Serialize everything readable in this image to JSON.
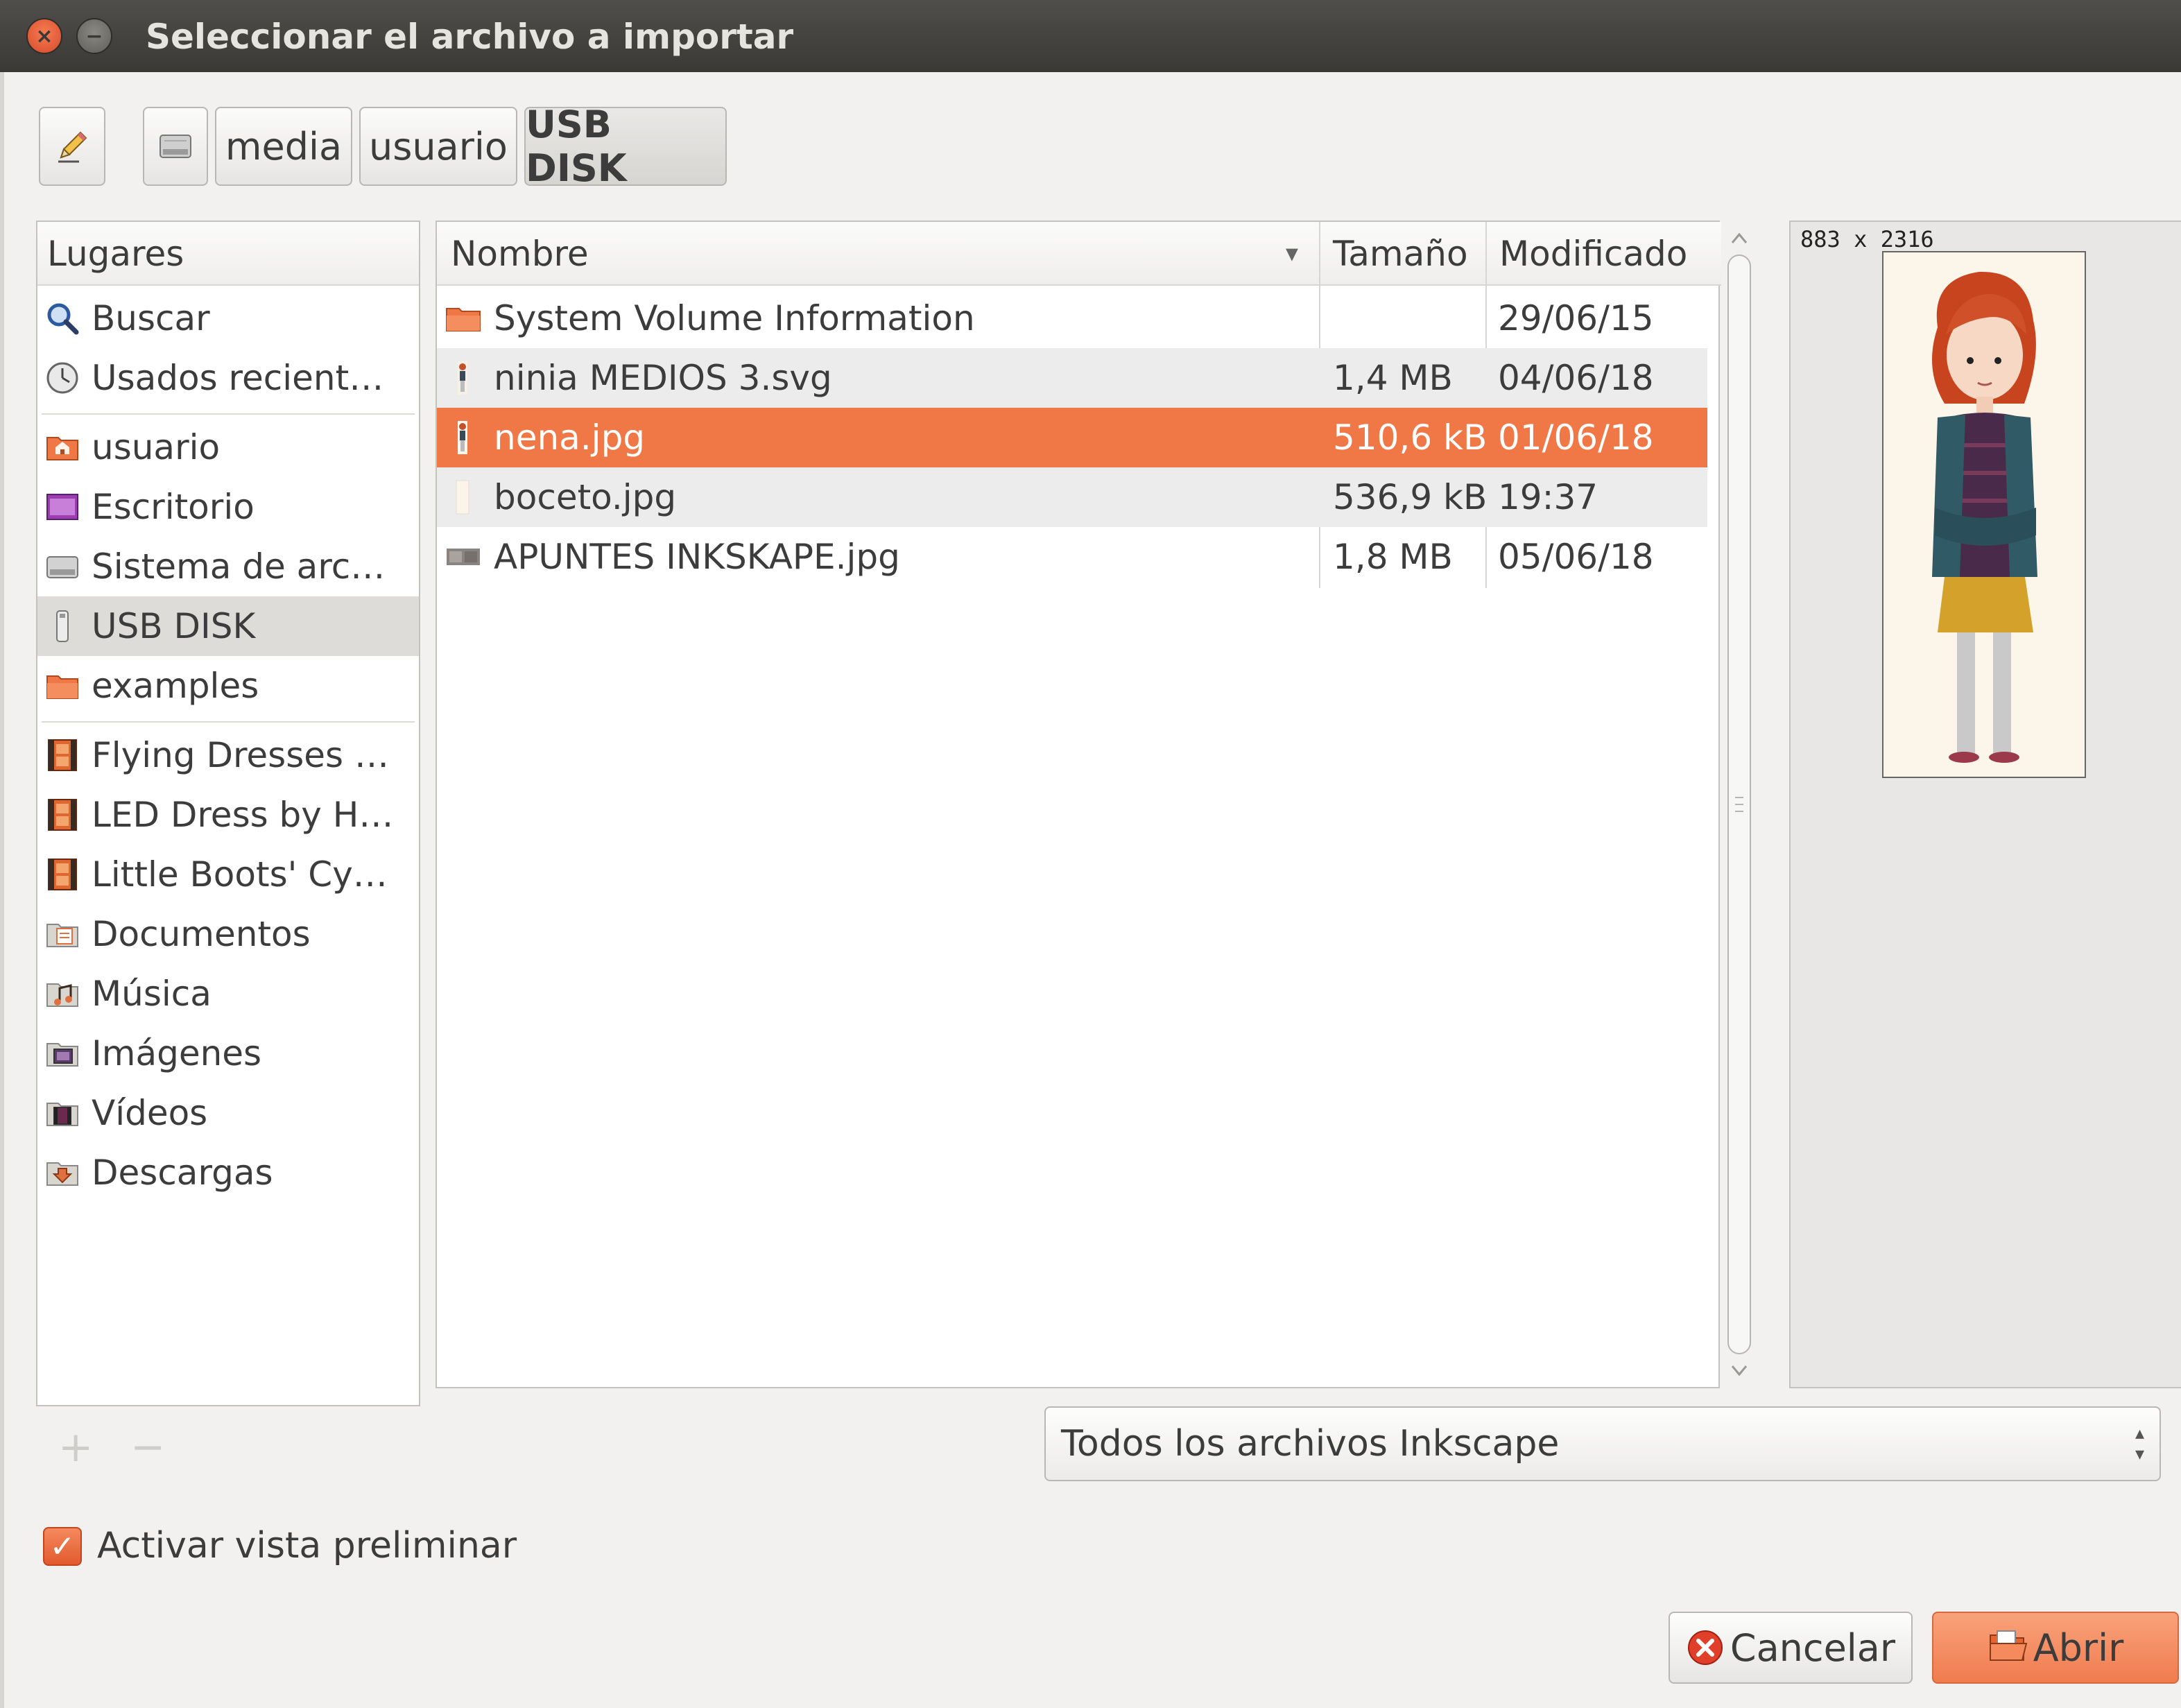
{
  "window": {
    "title": "Seleccionar el archivo a importar"
  },
  "pathbar": {
    "edit_icon": "pencil-icon",
    "drive_icon": "hard-drive-icon",
    "segments": [
      "media",
      "usuario",
      "USB DISK"
    ]
  },
  "places": {
    "header": "Lugares",
    "items": [
      {
        "label": "Buscar",
        "icon": "search-icon"
      },
      {
        "label": "Usados recient…",
        "icon": "recent-clock-icon"
      },
      {
        "label": "usuario",
        "icon": "home-folder-icon"
      },
      {
        "label": "Escritorio",
        "icon": "desktop-icon"
      },
      {
        "label": "Sistema de arc…",
        "icon": "filesystem-drive-icon"
      },
      {
        "label": "USB DISK",
        "icon": "usb-drive-icon"
      },
      {
        "label": "examples",
        "icon": "folder-icon"
      },
      {
        "label": "Flying Dresses …",
        "icon": "video-file-icon"
      },
      {
        "label": "LED Dress by H…",
        "icon": "video-file-icon"
      },
      {
        "label": "Little Boots' Cy…",
        "icon": "video-file-icon"
      },
      {
        "label": "Documentos",
        "icon": "documents-folder-icon"
      },
      {
        "label": "Música",
        "icon": "music-folder-icon"
      },
      {
        "label": "Imágenes",
        "icon": "pictures-folder-icon"
      },
      {
        "label": "Vídeos",
        "icon": "videos-folder-icon"
      },
      {
        "label": "Descargas",
        "icon": "downloads-folder-icon"
      }
    ],
    "add_label": "+",
    "remove_label": "−"
  },
  "files": {
    "columns": {
      "name": "Nombre",
      "size": "Tamaño",
      "modified": "Modificado"
    },
    "sort_indicator": "▾",
    "rows": [
      {
        "name": "System Volume Information",
        "size": "",
        "modified": "29/06/15",
        "icon": "folder-icon"
      },
      {
        "name": "ninia MEDIOS 3.svg",
        "size": "1,4 MB",
        "modified": "04/06/18",
        "icon": "image-thumbnail-icon"
      },
      {
        "name": "nena.jpg",
        "size": "510,6 kB",
        "modified": "01/06/18",
        "icon": "image-thumbnail-icon"
      },
      {
        "name": "boceto.jpg",
        "size": "536,9 kB",
        "modified": "19:37",
        "icon": "image-thumbnail-icon"
      },
      {
        "name": "APUNTES INKSKAPE.jpg",
        "size": "1,8 MB",
        "modified": "05/06/18",
        "icon": "image-thumbnail-icon"
      }
    ],
    "selected_index": 2
  },
  "preview": {
    "dimensions": "883 x 2316"
  },
  "filter": {
    "selected": "Todos los archivos Inkscape"
  },
  "options": {
    "preview_checkbox_label": "Activar vista preliminar",
    "preview_checked": true
  },
  "buttons": {
    "cancel": "Cancelar",
    "open": "Abrir"
  },
  "colors": {
    "selection": "#f07746",
    "titlebar": "#3c3b37",
    "close": "#e5572f"
  }
}
